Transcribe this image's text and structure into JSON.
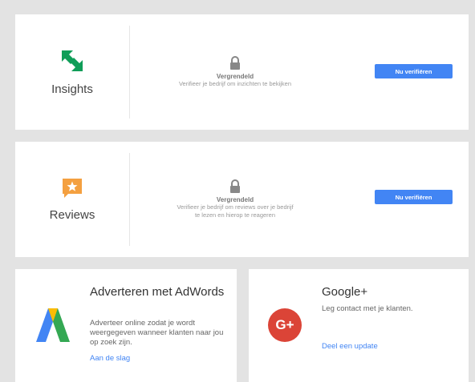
{
  "insights": {
    "title": "Insights",
    "lock_title": "Vergrendeld",
    "lock_desc": "Verifieer je bedrijf om inzichten te bekijken",
    "button": "Nu verifiëren",
    "icon": "insights-arrows-icon",
    "icon_color": "#0f9d58"
  },
  "reviews": {
    "title": "Reviews",
    "lock_title": "Vergrendeld",
    "lock_desc": "Verifieer je bedrijf om reviews over je bedrijf te lezen en hierop te reageren",
    "button": "Nu verifiëren",
    "icon": "review-star-icon",
    "icon_color": "#f4a040"
  },
  "adwords": {
    "title": "Adverteren met AdWords",
    "desc": "Adverteer online zodat je wordt weergegeven wanneer klanten naar jou op zoek zijn.",
    "link": "Aan de slag",
    "icon": "adwords-logo-icon"
  },
  "gplus": {
    "title": "Google+",
    "desc": "Leg contact met je klanten.",
    "link": "Deel een update",
    "icon_text": "G+",
    "icon": "google-plus-icon",
    "icon_color": "#db4437"
  },
  "colors": {
    "accent": "#4285f4",
    "background": "#e3e3e3"
  }
}
